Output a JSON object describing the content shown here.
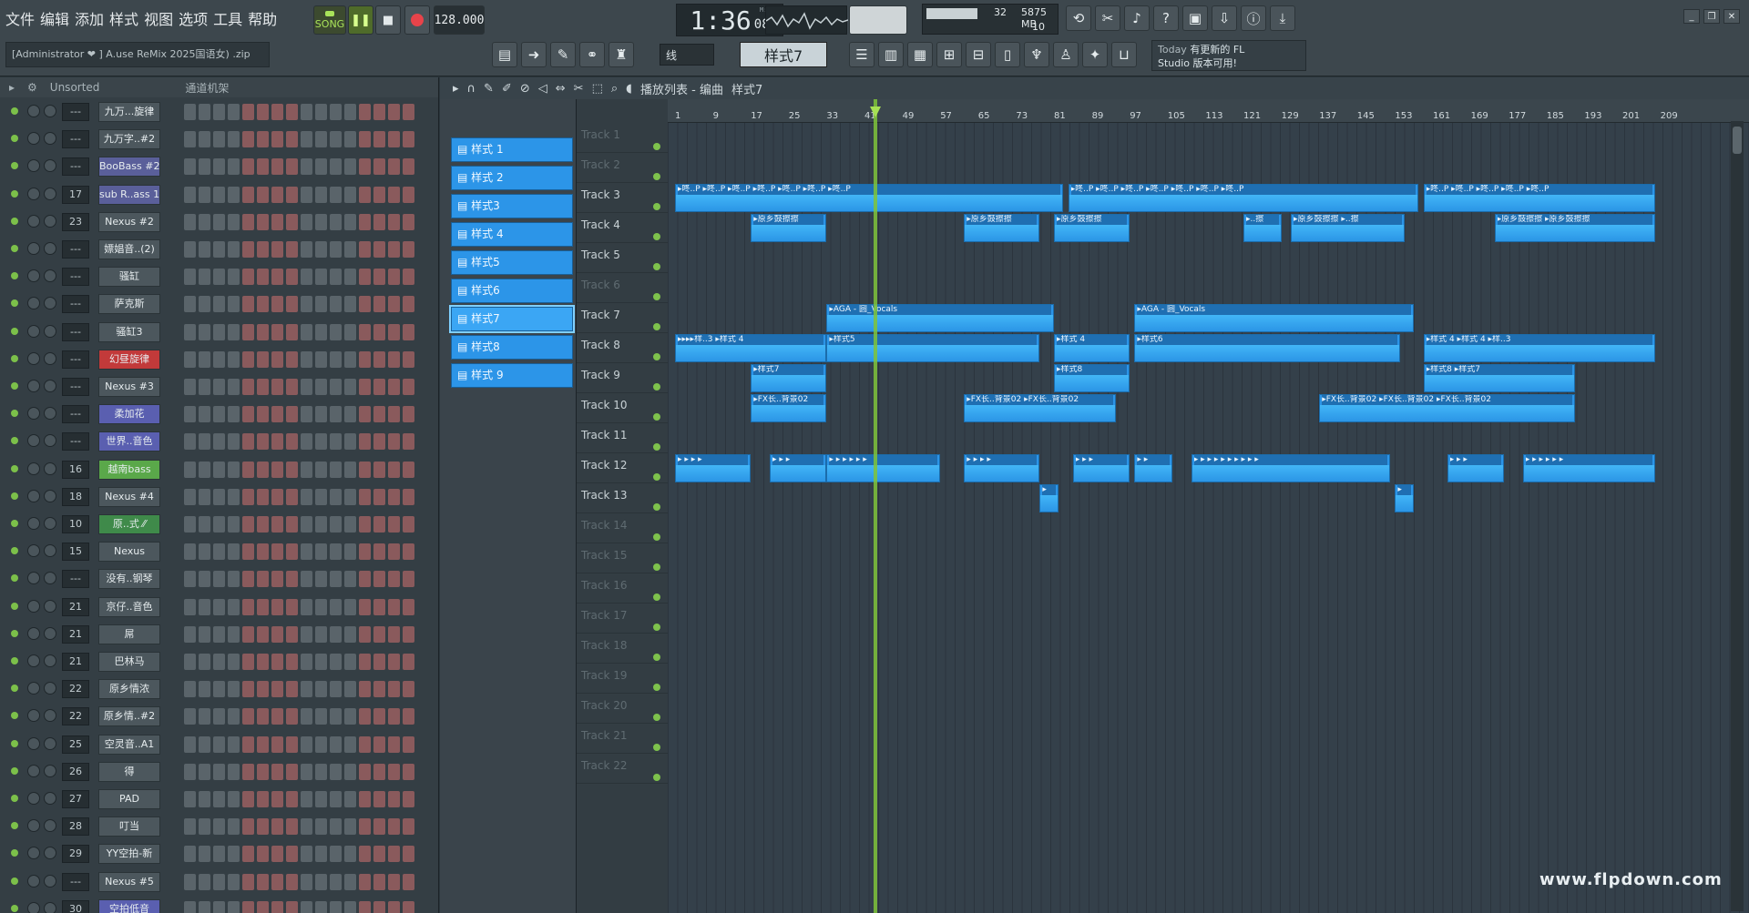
{
  "menu": [
    "文件",
    "编辑",
    "添加",
    "样式",
    "视图",
    "选项",
    "工具",
    "帮助"
  ],
  "project": {
    "user": "[Administrator ❤",
    "file": "] A.use ReMix 2025国语女) .zip"
  },
  "transport": {
    "song_label": "SONG",
    "tempo": "128.000",
    "time": "1:36",
    "time_small": "08",
    "mcs": "M:C:S"
  },
  "cpu": {
    "val1": "32",
    "val2": "5875 MB",
    "val3": "10"
  },
  "toolbar2": {
    "snap": "线",
    "pattern": "样式7"
  },
  "news": {
    "line1_prefix": "Today",
    "line1": "有更新的 FL",
    "line2": "Studio 版本可用!"
  },
  "rack": {
    "filter": "Unsorted",
    "title": "通道机架",
    "channels": [
      {
        "num": "---",
        "name": "九万...旋律",
        "color": "#4c575d"
      },
      {
        "num": "---",
        "name": "九万字..#2",
        "color": "#4c575d"
      },
      {
        "num": "---",
        "name": "BooBass #2",
        "color": "#5a5f9a"
      },
      {
        "num": "17",
        "name": "sub R..ass 1",
        "color": "#5a5f9a"
      },
      {
        "num": "23",
        "name": "Nexus #2",
        "color": "#4c575d"
      },
      {
        "num": "---",
        "name": "嫖娼音..(2)",
        "color": "#4c575d"
      },
      {
        "num": "---",
        "name": "骚缸",
        "color": "#4c575d"
      },
      {
        "num": "---",
        "name": "萨克斯",
        "color": "#4c575d"
      },
      {
        "num": "---",
        "name": "骚缸3",
        "color": "#4c575d"
      },
      {
        "num": "---",
        "name": "幻昼旋律",
        "color": "#c23a3a"
      },
      {
        "num": "---",
        "name": "Nexus #3",
        "color": "#4c575d"
      },
      {
        "num": "---",
        "name": "柔加花",
        "color": "#5a5fb0"
      },
      {
        "num": "---",
        "name": "世界..音色",
        "color": "#5a5fb0"
      },
      {
        "num": "16",
        "name": "越南bass",
        "color": "#5aa84a"
      },
      {
        "num": "18",
        "name": "Nexus #4",
        "color": "#4c575d"
      },
      {
        "num": "10",
        "name": "原..式 ⁄⁄",
        "color": "#3f8a4a"
      },
      {
        "num": "15",
        "name": "Nexus",
        "color": "#4c575d"
      },
      {
        "num": "---",
        "name": "没有..钢琴",
        "color": "#4c575d"
      },
      {
        "num": "21",
        "name": "京仔..音色",
        "color": "#4c575d"
      },
      {
        "num": "21",
        "name": "屌",
        "color": "#4c575d"
      },
      {
        "num": "21",
        "name": "巴林马",
        "color": "#4c575d"
      },
      {
        "num": "22",
        "name": "原乡情浓",
        "color": "#4c575d"
      },
      {
        "num": "22",
        "name": "原乡情..#2",
        "color": "#4c575d"
      },
      {
        "num": "25",
        "name": "空灵音..A1",
        "color": "#4c575d"
      },
      {
        "num": "26",
        "name": "得",
        "color": "#4c575d"
      },
      {
        "num": "27",
        "name": "PAD",
        "color": "#4c575d"
      },
      {
        "num": "28",
        "name": "叮当",
        "color": "#4c575d"
      },
      {
        "num": "29",
        "name": "YY空拍-新",
        "color": "#4c575d"
      },
      {
        "num": "---",
        "name": "Nexus #5",
        "color": "#4c575d"
      },
      {
        "num": "30",
        "name": "空拍低音",
        "color": "#5a5fb0"
      }
    ]
  },
  "playlist": {
    "title": "播放列表 - 编曲",
    "crumb": "样式7",
    "patterns": [
      "样式 1",
      "样式 2",
      "样式3",
      "样式 4",
      "样式5",
      "样式6",
      "样式7",
      "样式8",
      "样式 9"
    ],
    "selected_pattern": 6,
    "ruler": [
      "1",
      "9",
      "17",
      "25",
      "33",
      "41",
      "49",
      "57",
      "65",
      "73",
      "81",
      "89",
      "97",
      "105",
      "113",
      "121",
      "129",
      "137",
      "145",
      "153",
      "161",
      "169",
      "177",
      "185",
      "193",
      "201",
      "209"
    ],
    "tracks": [
      "Track 1",
      "Track 2",
      "Track 3",
      "Track 4",
      "Track 5",
      "Track 6",
      "Track 7",
      "Track 8",
      "Track 9",
      "Track 10",
      "Track 11",
      "Track 12",
      "Track 13",
      "Track 14",
      "Track 15",
      "Track 16",
      "Track 17",
      "Track 18",
      "Track 19",
      "Track 20",
      "Track 21",
      "Track 22"
    ],
    "dim_tracks": [
      0,
      1,
      5,
      13,
      14,
      15,
      16,
      17,
      18,
      19,
      20,
      21
    ],
    "clips": [
      {
        "track": 2,
        "start": 1,
        "len": 82,
        "label": "▸咚..P ▸咚..P ▸咚..P ▸咚..P ▸咚..P ▸咚..P ▸咚..P"
      },
      {
        "track": 2,
        "start": 84,
        "len": 74,
        "label": "▸咚..P ▸咚..P ▸咚..P ▸咚..P ▸咚..P ▸咚..P ▸咚..P"
      },
      {
        "track": 2,
        "start": 159,
        "len": 49,
        "label": "▸咚..P ▸咚..P ▸咚..P ▸咚..P ▸咚..P"
      },
      {
        "track": 3,
        "start": 17,
        "len": 16,
        "label": "▸原乡鼓擦擦"
      },
      {
        "track": 3,
        "start": 62,
        "len": 16,
        "label": "▸原乡鼓擦擦"
      },
      {
        "track": 3,
        "start": 81,
        "len": 16,
        "label": "▸原乡鼓擦擦"
      },
      {
        "track": 3,
        "start": 121,
        "len": 8,
        "label": "▸..擦"
      },
      {
        "track": 3,
        "start": 131,
        "len": 24,
        "label": "▸原乡鼓擦擦 ▸..擦"
      },
      {
        "track": 3,
        "start": 174,
        "len": 34,
        "label": "▸原乡鼓擦擦 ▸原乡鼓擦擦"
      },
      {
        "track": 6,
        "start": 33,
        "len": 48,
        "label": "▸AGA - 圆_Vocals"
      },
      {
        "track": 6,
        "start": 98,
        "len": 59,
        "label": "▸AGA - 圆_Vocals"
      },
      {
        "track": 7,
        "start": 1,
        "len": 32,
        "label": "▸▸▸▸样..3 ▸样式 4"
      },
      {
        "track": 7,
        "start": 33,
        "len": 45,
        "label": "▸样式5"
      },
      {
        "track": 7,
        "start": 81,
        "len": 16,
        "label": "▸样式 4"
      },
      {
        "track": 7,
        "start": 98,
        "len": 56,
        "label": "▸样式6"
      },
      {
        "track": 7,
        "start": 159,
        "len": 49,
        "label": "▸样式 4 ▸样式 4 ▸样..3"
      },
      {
        "track": 8,
        "start": 17,
        "len": 16,
        "label": "▸样式7"
      },
      {
        "track": 8,
        "start": 81,
        "len": 16,
        "label": "▸样式8"
      },
      {
        "track": 8,
        "start": 159,
        "len": 32,
        "label": "▸样式8 ▸样式7"
      },
      {
        "track": 9,
        "start": 17,
        "len": 16,
        "label": "▸FX长..背景02"
      },
      {
        "track": 9,
        "start": 62,
        "len": 32,
        "label": "▸FX长..背景02 ▸FX长..背景02"
      },
      {
        "track": 9,
        "start": 137,
        "len": 54,
        "label": "▸FX长..背景02 ▸FX长..背景02 ▸FX长..背景02"
      },
      {
        "track": 11,
        "start": 1,
        "len": 16,
        "label": "▸ ▸ ▸ ▸"
      },
      {
        "track": 11,
        "start": 21,
        "len": 12,
        "label": "▸ ▸ ▸"
      },
      {
        "track": 11,
        "start": 33,
        "len": 24,
        "label": "▸ ▸ ▸ ▸ ▸ ▸"
      },
      {
        "track": 11,
        "start": 62,
        "len": 16,
        "label": "▸ ▸ ▸ ▸"
      },
      {
        "track": 11,
        "start": 85,
        "len": 12,
        "label": "▸ ▸ ▸"
      },
      {
        "track": 11,
        "start": 98,
        "len": 8,
        "label": "▸ ▸"
      },
      {
        "track": 11,
        "start": 110,
        "len": 42,
        "label": "▸ ▸ ▸ ▸ ▸ ▸ ▸ ▸ ▸ ▸"
      },
      {
        "track": 11,
        "start": 164,
        "len": 12,
        "label": "▸ ▸ ▸"
      },
      {
        "track": 11,
        "start": 180,
        "len": 28,
        "label": "▸ ▸ ▸ ▸ ▸ ▸"
      },
      {
        "track": 12,
        "start": 78,
        "len": 4,
        "label": "▸"
      },
      {
        "track": 12,
        "start": 153,
        "len": 4,
        "label": "▸"
      }
    ]
  },
  "watermark": "www.flpdown.com"
}
